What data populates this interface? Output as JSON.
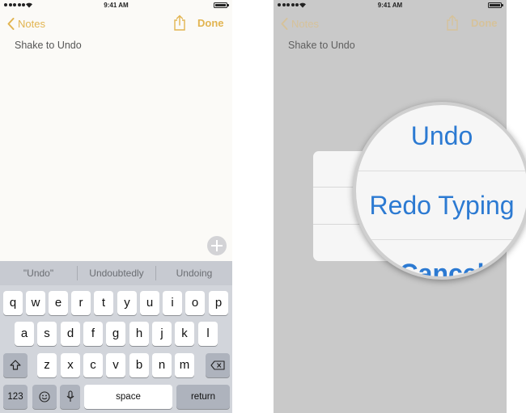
{
  "status_bar": {
    "time": "9:41 AM"
  },
  "left_screen": {
    "nav": {
      "back_label": "Notes",
      "done_label": "Done"
    },
    "note_text": "Shake to Undo",
    "predictive": [
      "\"Undo\"",
      "Undoubtedly",
      "Undoing"
    ],
    "keyboard": {
      "row1": [
        "q",
        "w",
        "e",
        "r",
        "t",
        "y",
        "u",
        "i",
        "o",
        "p"
      ],
      "row2": [
        "a",
        "s",
        "d",
        "f",
        "g",
        "h",
        "j",
        "k",
        "l"
      ],
      "row3": [
        "z",
        "x",
        "c",
        "v",
        "b",
        "n",
        "m"
      ],
      "numbers_label": "123",
      "space_label": "space",
      "return_label": "return"
    }
  },
  "right_screen": {
    "nav": {
      "back_label": "Notes",
      "done_label": "Done"
    },
    "note_text": "Shake to Undo",
    "undo_alert": {
      "undo_label": "Undo",
      "redo_label": "Redo Typing",
      "cancel_label": "Cancel"
    }
  },
  "colors": {
    "accent": "#e2b450",
    "alert_blue": "#2c7ad2",
    "dim_overlay": "#c9c9c9"
  },
  "icons": [
    "chevron-left-icon",
    "share-icon",
    "signal-icon",
    "wifi-icon",
    "battery-icon",
    "plus-icon",
    "shift-icon",
    "delete-icon",
    "emoji-icon",
    "microphone-icon"
  ]
}
